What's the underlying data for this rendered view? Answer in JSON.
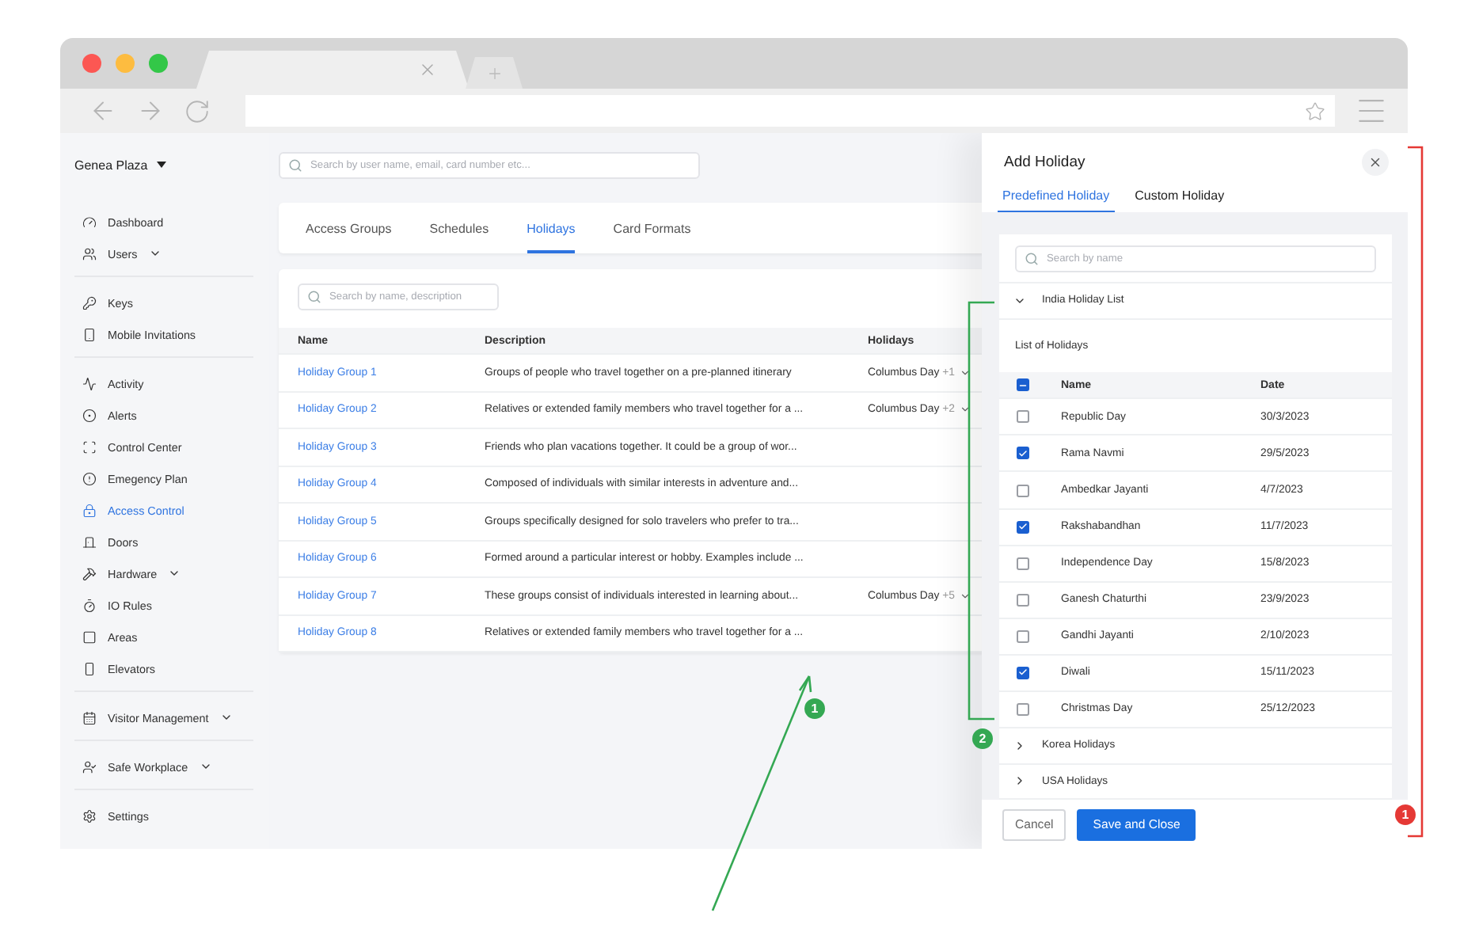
{
  "sidebar": {
    "location": "Genea Plaza",
    "sections": [
      {
        "items": [
          {
            "label": "Dashboard",
            "submenu": false,
            "selected": false
          },
          {
            "label": "Users",
            "submenu": true,
            "selected": false
          }
        ]
      },
      {
        "items": [
          {
            "label": "Keys",
            "submenu": false,
            "selected": false
          },
          {
            "label": "Mobile Invitations",
            "submenu": false,
            "selected": false
          }
        ]
      },
      {
        "items": [
          {
            "label": "Activity",
            "submenu": false,
            "selected": false
          },
          {
            "label": "Alerts",
            "submenu": false,
            "selected": false
          },
          {
            "label": "Control Center",
            "submenu": false,
            "selected": false
          },
          {
            "label": "Emegency Plan",
            "submenu": false,
            "selected": false
          },
          {
            "label": "Access Control",
            "submenu": false,
            "selected": true
          },
          {
            "label": "Doors",
            "submenu": false,
            "selected": false
          },
          {
            "label": "Hardware",
            "submenu": true,
            "selected": false
          },
          {
            "label": "IO Rules",
            "submenu": false,
            "selected": false
          },
          {
            "label": "Areas",
            "submenu": false,
            "selected": false
          },
          {
            "label": "Elevators",
            "submenu": false,
            "selected": false
          }
        ]
      },
      {
        "items": [
          {
            "label": "Visitor Management",
            "submenu": true,
            "selected": false
          }
        ]
      },
      {
        "items": [
          {
            "label": "Safe Workplace",
            "submenu": true,
            "selected": false
          }
        ]
      },
      {
        "items": [
          {
            "label": "Settings",
            "submenu": false,
            "selected": false
          }
        ]
      }
    ]
  },
  "search": {
    "placeholder": "Search by user name, email, card number etc..."
  },
  "tabs": [
    {
      "label": "Access Groups",
      "selected": false
    },
    {
      "label": "Schedules",
      "selected": false
    },
    {
      "label": "Holidays",
      "selected": true
    },
    {
      "label": "Card Formats",
      "selected": false
    }
  ],
  "table": {
    "search_placeholder": "Search by name, description",
    "columns": [
      "Name",
      "Description",
      "Holidays"
    ],
    "rows": [
      {
        "name": "Holiday Group 1",
        "description": "Groups of people who travel together on a pre-planned itinerary",
        "holidays": "Columbus Day",
        "more": "+1"
      },
      {
        "name": "Holiday Group 2",
        "description": "Relatives or extended family members who travel together for a ...",
        "holidays": "Columbus Day",
        "more": "+2"
      },
      {
        "name": "Holiday Group 3",
        "description": "Friends who plan vacations together. It could be a group of wor..."
      },
      {
        "name": "Holiday Group 4",
        "description": "Composed of individuals with similar interests in adventure and..."
      },
      {
        "name": "Holiday Group 5",
        "description": "Groups specifically designed for solo travelers who prefer to tra..."
      },
      {
        "name": "Holiday Group 6",
        "description": "Formed around a particular interest or hobby. Examples include ..."
      },
      {
        "name": "Holiday Group 7",
        "description": "These groups consist of individuals interested in learning about...",
        "holidays": "Columbus Day",
        "more": "+5"
      },
      {
        "name": "Holiday Group 8",
        "description": "Relatives or extended family members who travel together for a ..."
      }
    ]
  },
  "drawer": {
    "title": "Add Holiday",
    "tabs": [
      {
        "label": "Predefined Holiday",
        "selected": true
      },
      {
        "label": "Custom Holiday",
        "selected": false
      }
    ],
    "search_placeholder": "Search by name",
    "groups": [
      {
        "name": "India Holiday List",
        "expanded": true,
        "caption": "List of Holidays",
        "select_all_indeterminate": true,
        "columns": [
          "Name",
          "Date"
        ],
        "rows": [
          {
            "name": "Republic Day",
            "date": "30/3/2023",
            "checked": false
          },
          {
            "name": "Rama Navmi",
            "date": "29/5/2023",
            "checked": true
          },
          {
            "name": "Ambedkar Jayanti",
            "date": "4/7/2023",
            "checked": false
          },
          {
            "name": "Rakshabandhan",
            "date": "11/7/2023",
            "checked": true
          },
          {
            "name": "Independence Day",
            "date": "15/8/2023",
            "checked": false
          },
          {
            "name": "Ganesh Chaturthi",
            "date": "23/9/2023",
            "checked": false
          },
          {
            "name": "Gandhi Jayanti",
            "date": "2/10/2023",
            "checked": false
          },
          {
            "name": "Diwali",
            "date": "15/11/2023",
            "checked": true
          },
          {
            "name": "Christmas Day",
            "date": "25/12/2023",
            "checked": false
          }
        ]
      },
      {
        "name": "Korea Holidays",
        "expanded": false
      },
      {
        "name": "USA Holidays",
        "expanded": false
      }
    ],
    "buttons": [
      {
        "label": "Cancel",
        "kind": "secondary"
      },
      {
        "label": "Save and Close",
        "kind": "primary"
      }
    ]
  },
  "annotations": [
    {
      "kind": "list-bracket",
      "label": "2",
      "color": "#34a853"
    },
    {
      "kind": "arrow",
      "label": "1",
      "color": "#34a853"
    },
    {
      "kind": "drawer-bracket",
      "label": "1",
      "color": "#e53935"
    }
  ]
}
